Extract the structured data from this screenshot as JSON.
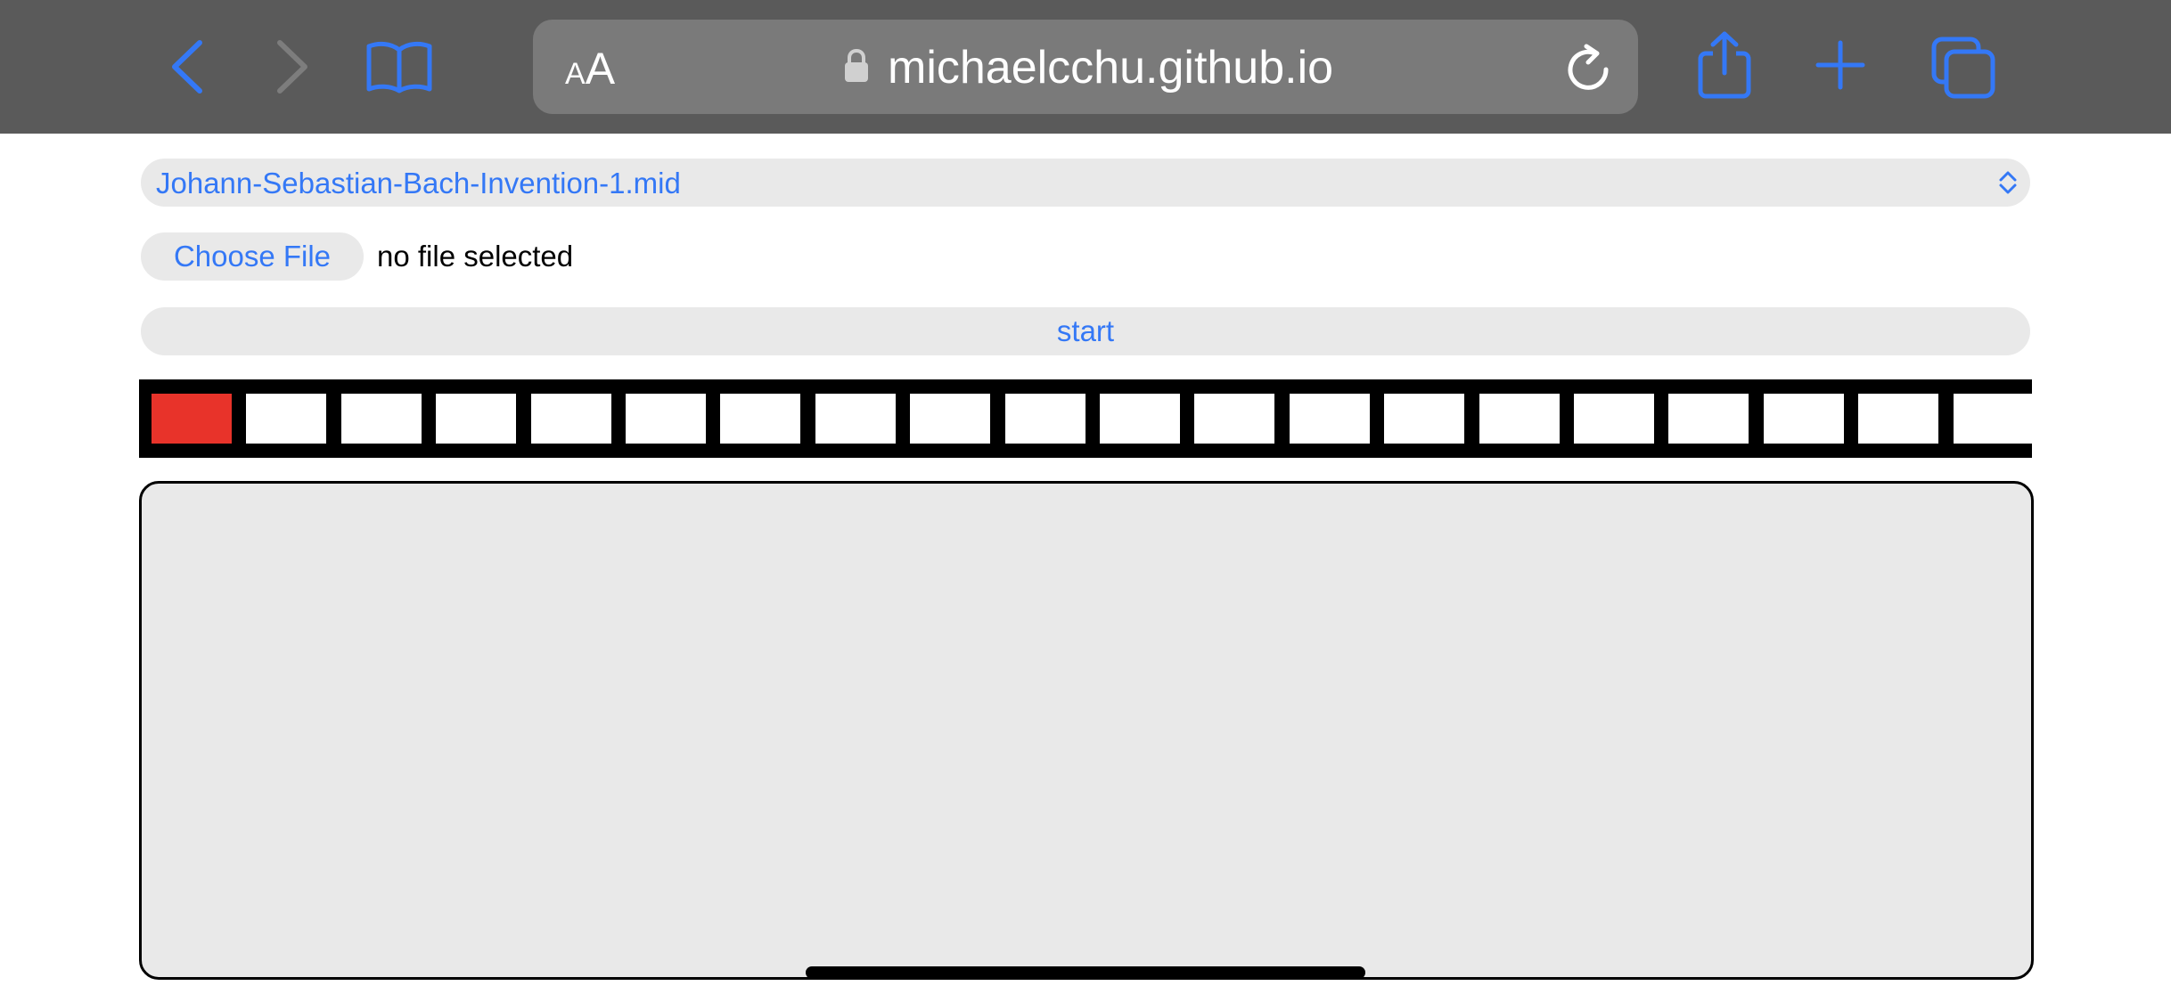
{
  "browser": {
    "url": "michaelcchu.github.io",
    "text_size_label_small": "A",
    "text_size_label_large": "A",
    "accent_color": "#3478f6",
    "toolbar_color": "#5a5a5a"
  },
  "page": {
    "midi_select": {
      "selected": "Johann-Sebastian-Bach-Invention-1.mid"
    },
    "file_input": {
      "button_label": "Choose File",
      "status": "no file selected"
    },
    "start_button": {
      "label": "start"
    },
    "sequencer": {
      "visible_steps": 20,
      "active_step": 1,
      "active_color": "#e8332a"
    }
  }
}
